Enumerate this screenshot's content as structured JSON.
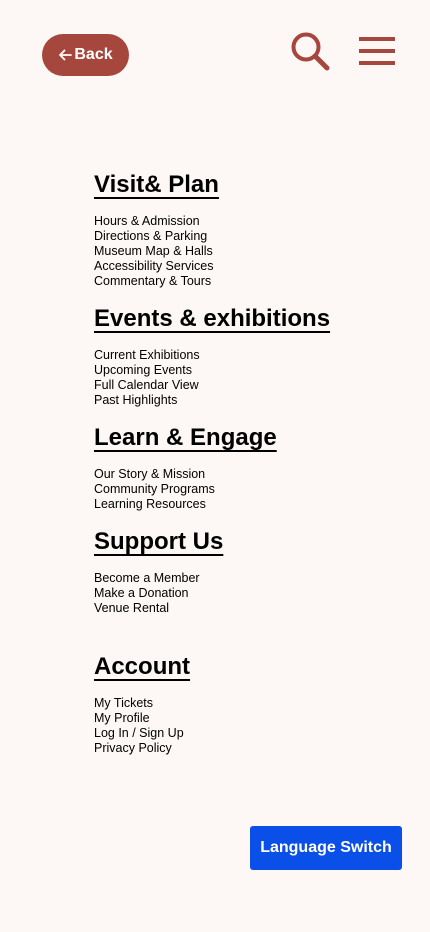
{
  "header": {
    "back_arrow": "←",
    "back_label": "Back",
    "search_icon": "search-icon",
    "menu_icon": "hamburger-menu-icon",
    "accent_color": "#a6473e"
  },
  "nav": {
    "sections": [
      {
        "title": "Visit& Plan",
        "items": [
          "Hours & Admission",
          "Directions & Parking",
          "Museum Map & Halls",
          "Accessibility Services",
          "Commentary & Tours"
        ]
      },
      {
        "title": "Events & exhibitions",
        "items": [
          "Current Exhibitions",
          "Upcoming Events",
          "Full Calendar View",
          "Past Highlights"
        ]
      },
      {
        "title": "Learn & Engage",
        "items": [
          "Our Story & Mission",
          "Community Programs",
          "Learning Resources"
        ]
      },
      {
        "title": "Support Us",
        "items": [
          "Become a Member",
          "Make a Donation",
          "Venue Rental"
        ]
      },
      {
        "title": "Account",
        "items": [
          "My Tickets",
          "My Profile",
          "Log In / Sign Up",
          "Privacy Policy"
        ]
      }
    ]
  },
  "footer": {
    "language_label": "Language Switch",
    "language_color": "#0a4fe8"
  }
}
